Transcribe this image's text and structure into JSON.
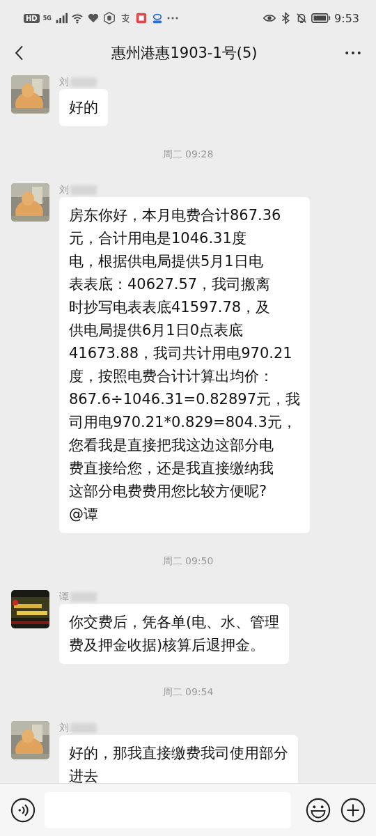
{
  "status_bar": {
    "badges": [
      "HD",
      "5G"
    ],
    "time": "9:53"
  },
  "header": {
    "title": "惠州港惠1903-1号(5)"
  },
  "messages": [
    {
      "kind": "message",
      "sender": "刘",
      "lines": [
        "好的"
      ]
    },
    {
      "kind": "time",
      "text": "周二 09:28"
    },
    {
      "kind": "message",
      "sender": "刘",
      "lines": [
        "房东你好，本月电费合计867.36",
        "元，合计用电是1046.31度",
        "电，根据供电局提供5月1日电",
        "表表底：40627.57，我司搬离",
        "时抄写电表表底41597.78，及",
        "供电局提供6月1日0点表底",
        "41673.88，我司共计用电970.21",
        "度，按照电费合计计算出均价：",
        "867.6÷1046.31=0.82897元，我",
        "司用电970.21*0.829=804.3元，",
        "您看我是直接把我这边这部分电",
        "费直接给您，还是我直接缴纳我",
        "这部分电费费用您比较方便呢?",
        "@谭"
      ]
    },
    {
      "kind": "time",
      "text": "周二 09:50"
    },
    {
      "kind": "message",
      "sender": "谭",
      "lines": [
        "你交费后，凭各单(电、水、管理",
        "费及押金收据)核算后退押金。"
      ]
    },
    {
      "kind": "time",
      "text": "周二 09:54"
    },
    {
      "kind": "message",
      "sender": "刘",
      "lines": [
        "好的，那我直接缴费我司使用部分",
        "进去"
      ]
    }
  ]
}
